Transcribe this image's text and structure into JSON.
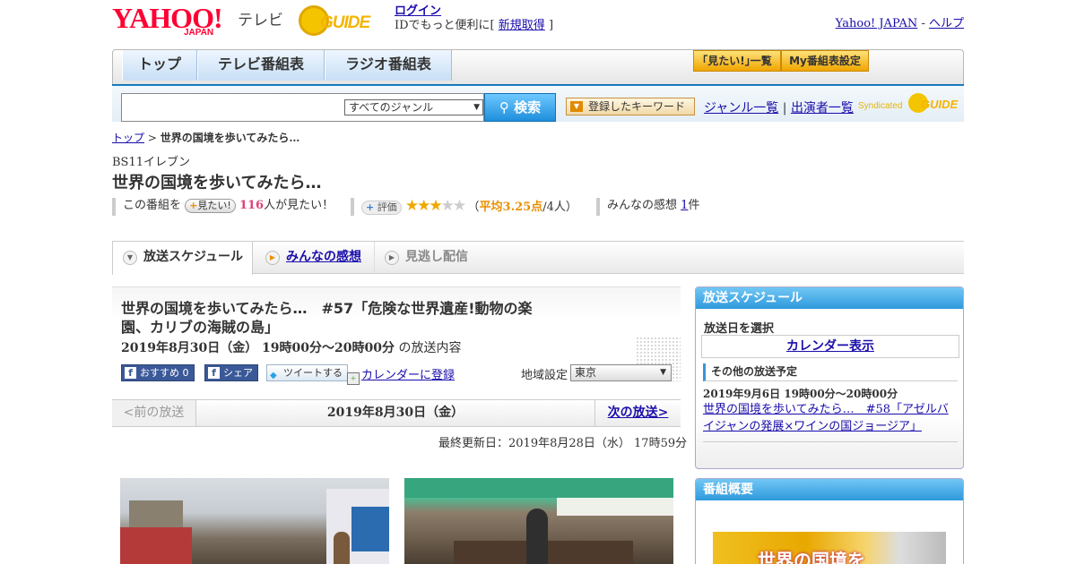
{
  "header": {
    "logo_text": "YAHOO!",
    "logo_sub": "JAPAN",
    "service": "テレビ",
    "gguide_logo": "GUIDE",
    "login_label": "ログイン",
    "login_tagline": "IDでもっと便利に[",
    "signup_label": "新規取得",
    "login_tagline_end": "]",
    "link_yahoo": "Yahoo! JAPAN",
    "link_sep": "-",
    "link_help": "ヘルプ"
  },
  "nav": {
    "tabs": [
      {
        "label": "トップ"
      },
      {
        "label": "テレビ番組表"
      },
      {
        "label": "ラジオ番組表"
      }
    ],
    "watchlist_label": "｢見たい!｣一覧",
    "mybangumi_label": "My番組表設定"
  },
  "search": {
    "placeholder": "",
    "genre_selected": "すべてのジャンル",
    "button_label": "検索",
    "keyword_button": "登録したキーワード",
    "link_genre": "ジャンル一覧",
    "link_sep": "|",
    "link_cast": "出演者一覧",
    "syndicated": "Syndicated",
    "syndicated_logo": "GUIDE"
  },
  "breadcrumb": {
    "top": "トップ",
    "sep": ">",
    "current": "世界の国境を歩いてみたら…"
  },
  "program": {
    "channel": "BS11イレブン",
    "title": "世界の国境を歩いてみたら…",
    "want_prefix": "この番組を",
    "want_button": "見たい!",
    "want_count": "116",
    "want_suffix": "人が見たい！",
    "rating_button": "評価",
    "rating_value": 3.25,
    "rating_text_open": "（",
    "rating_avg": "平均3.25点",
    "rating_people": "/4人）",
    "review_label": "みんなの感想",
    "review_count": "1",
    "review_suffix": "件"
  },
  "tabs": {
    "schedule": "放送スケジュール",
    "reviews": "みんなの感想",
    "missed": "見逃し配信"
  },
  "episode": {
    "title": "世界の国境を歩いてみたら…　#57「危険な世界遺産!動物の楽園、カリブの海賊の島」",
    "time": "2019年8月30日（金）  19時00分～20時00分",
    "time_suffix": "の放送内容",
    "fb_recommend": "おすすめ 0",
    "fb_share": "シェア",
    "tweet": "ツイートする",
    "calendar": "カレンダーに登録",
    "region_label": "地域設定",
    "region_selected": "東京"
  },
  "datenav": {
    "prev": "<前の放送",
    "current": "2019年8月30日（金）",
    "next": "次の放送>"
  },
  "updated": "最終更新日：2019年8月28日（水）  17時59分",
  "sidebar": {
    "schedule_head": "放送スケジュール",
    "select_date": "放送日を選択",
    "calendar_button": "カレンダー表示",
    "other_head": "その他の放送予定",
    "other_time": "2019年9月6日  19時00分～20時00分",
    "other_title": "世界の国境を歩いてみたら…　#58「アゼルバイジャンの発展×ワインの国ジョージア」",
    "overview_head": "番組概要",
    "overview_caption": "世界の国境を"
  },
  "colors": {
    "accent_blue": "#1b8bd1",
    "link": "#1a0dab",
    "yahoo_red": "#ff0033",
    "star": "#f0a800"
  }
}
